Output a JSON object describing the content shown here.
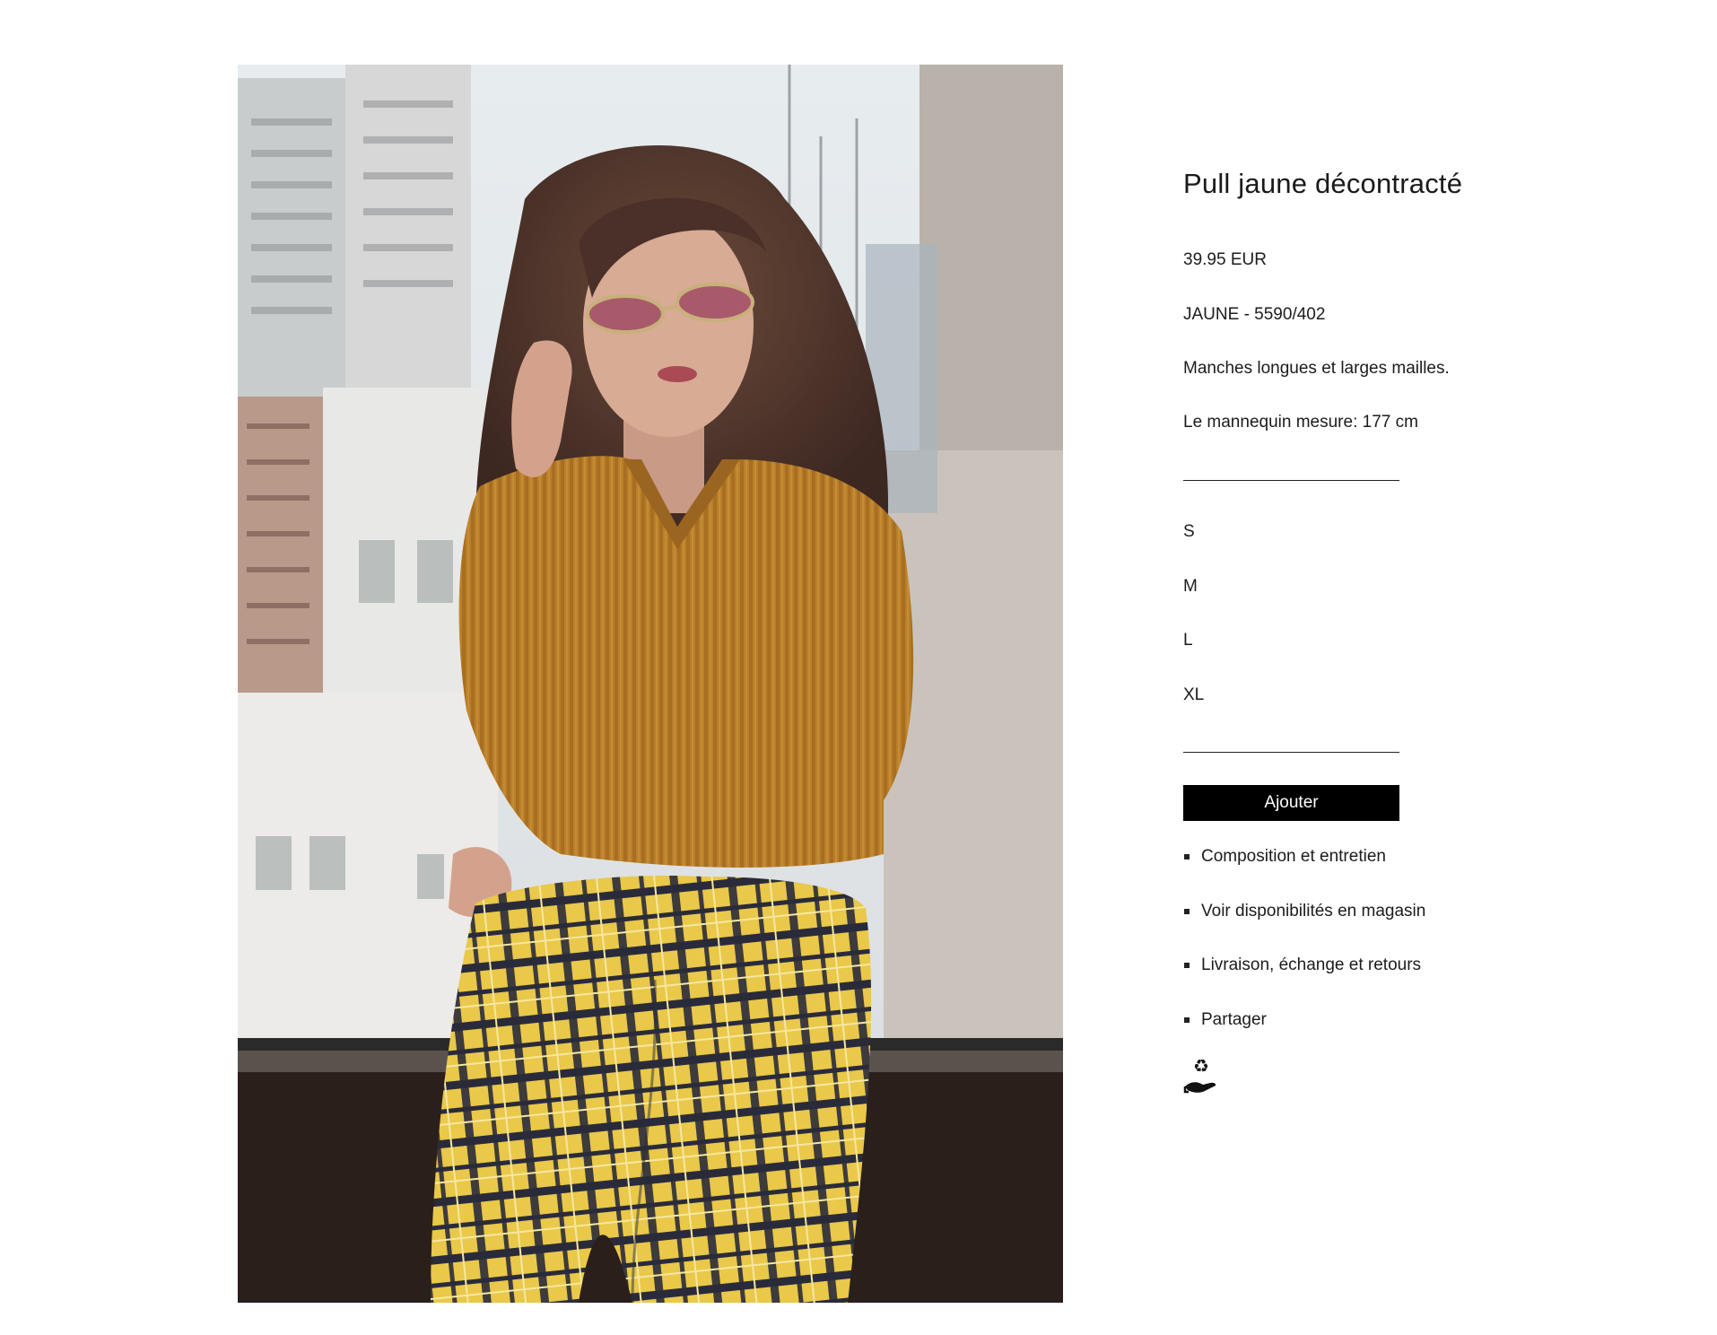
{
  "product": {
    "title": "Pull jaune décontracté",
    "price": "39.95 EUR",
    "reference": "JAUNE - 5590/402",
    "description": "Manches longues et larges mailles.",
    "model_height": "Le mannequin mesure: 177 cm"
  },
  "sizes": [
    "S",
    "M",
    "L",
    "XL"
  ],
  "add_button_label": "Ajouter",
  "links": [
    "Composition et entretien",
    "Voir disponibilités en magasin",
    "Livraison, échange et retours",
    "Partager"
  ],
  "icons": {
    "bullet": "square-bullet-icon",
    "sustainability": "recycle-hand-icon"
  }
}
